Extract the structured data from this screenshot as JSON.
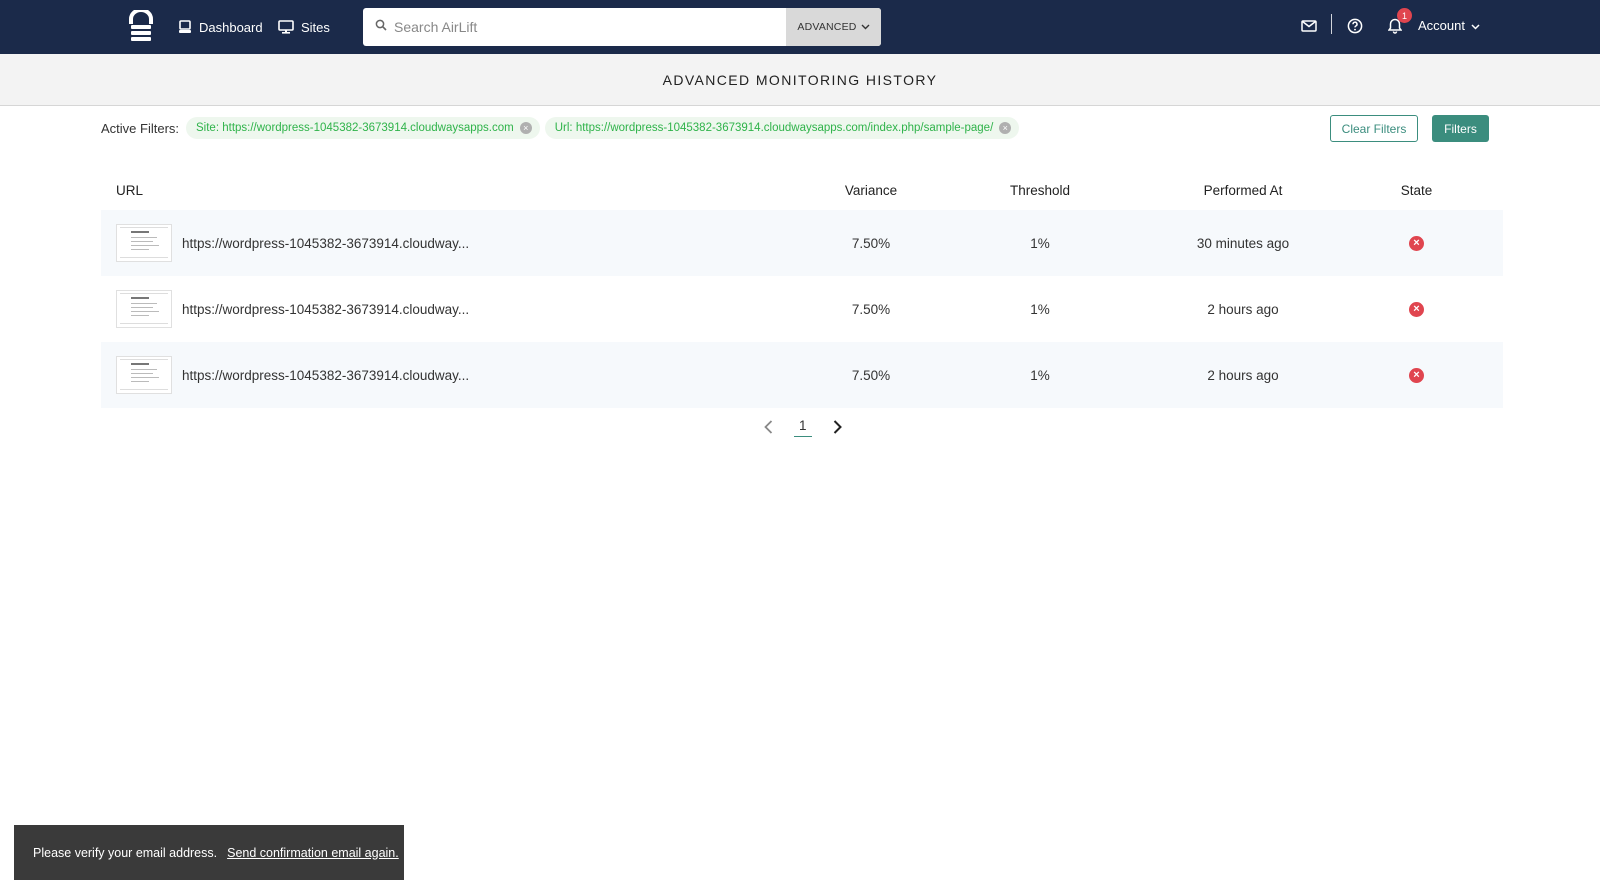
{
  "nav": {
    "logo_icon": "airlift-lock-icon",
    "dashboard_label": "Dashboard",
    "sites_label": "Sites",
    "search_placeholder": "Search AirLift",
    "advanced_label": "ADVANCED",
    "notifications_count": "1",
    "account_label": "Account"
  },
  "page": {
    "title": "ADVANCED MONITORING HISTORY"
  },
  "filters": {
    "label": "Active Filters:",
    "chips": [
      {
        "text": "Site: https://wordpress-1045382-3673914.cloudwaysapps.com"
      },
      {
        "text": "Url: https://wordpress-1045382-3673914.cloudwaysapps.com/index.php/sample-page/"
      }
    ],
    "clear_label": "Clear Filters",
    "filters_label": "Filters"
  },
  "table": {
    "headers": {
      "url": "URL",
      "variance": "Variance",
      "threshold": "Threshold",
      "performed_at": "Performed At",
      "state": "State"
    },
    "rows": [
      {
        "url": "https://wordpress-1045382-3673914.cloudway...",
        "variance": "7.50%",
        "threshold": "1%",
        "performed_at": "30 minutes ago",
        "state": "failed"
      },
      {
        "url": "https://wordpress-1045382-3673914.cloudway...",
        "variance": "7.50%",
        "threshold": "1%",
        "performed_at": "2 hours ago",
        "state": "failed"
      },
      {
        "url": "https://wordpress-1045382-3673914.cloudway...",
        "variance": "7.50%",
        "threshold": "1%",
        "performed_at": "2 hours ago",
        "state": "failed"
      }
    ]
  },
  "pagination": {
    "current_page": "1"
  },
  "toast": {
    "message": "Please verify your email address.",
    "link_text": "Send confirmation email again."
  },
  "colors": {
    "navbar": "#1b2a4a",
    "accent": "#3b8d7e",
    "chip_text": "#2fb34a",
    "error": "#e0454f"
  }
}
